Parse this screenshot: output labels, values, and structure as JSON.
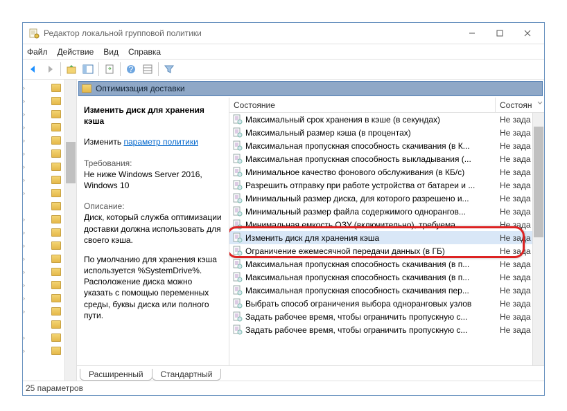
{
  "window": {
    "title": "Редактор локальной групповой политики"
  },
  "menu": {
    "file": "Файл",
    "action": "Действие",
    "view": "Вид",
    "help": "Справка"
  },
  "path_header": "Оптимизация доставки",
  "desc": {
    "setting_title": "Изменить диск для хранения кэша",
    "edit_label": "Изменить",
    "edit_link": "параметр политики",
    "req_label": "Требования:",
    "req_body": "Не ниже Windows Server 2016, Windows 10",
    "desc_label": "Описание:",
    "desc_body": "Диск, который служба оптимизации доставки должна использовать для своего кэша.",
    "desc_body2": "По умолчанию для хранения кэша используется %SystemDrive%. Расположение диска можно указать с помощью переменных среды, буквы диска или полного пути."
  },
  "columns": {
    "state": "Состояние",
    "state2": "Состоян"
  },
  "rows": [
    {
      "name": "Максимальный срок хранения в кэше (в секундах)",
      "state": "Не зада"
    },
    {
      "name": "Максимальный размер кэша (в процентах)",
      "state": "Не зада"
    },
    {
      "name": "Максимальная пропускная способность скачивания (в К...",
      "state": "Не зада"
    },
    {
      "name": "Максимальная пропускная способность выкладывания (...",
      "state": "Не зада"
    },
    {
      "name": "Минимальное качество фонового обслуживания (в КБ/с)",
      "state": "Не зада"
    },
    {
      "name": "Разрешить отправку при работе устройства от батареи и ...",
      "state": "Не зада"
    },
    {
      "name": "Минимальный размер диска, для которого разрешено и...",
      "state": "Не зада"
    },
    {
      "name": "Минимальный размер файла содержимого однорангов...",
      "state": "Не зада"
    },
    {
      "name": "Минимальная емкость ОЗУ (включительно), требуема...",
      "state": "Не зада"
    },
    {
      "name": "Изменить диск для хранения кэша",
      "state": "Не зада",
      "selected": true
    },
    {
      "name": "Ограничение ежемесячной передачи данных (в ГБ)",
      "state": "Не зада"
    },
    {
      "name": "Максимальная пропускная способность скачивания (в п...",
      "state": "Не зада"
    },
    {
      "name": "Максимальная пропускная способность скачивания (в п...",
      "state": "Не зада"
    },
    {
      "name": "Максимальная пропускная способность скачивания пер...",
      "state": "Не зада"
    },
    {
      "name": "Выбрать способ ограничения выбора одноранговых узлов",
      "state": "Не зада"
    },
    {
      "name": "Задать рабочее время, чтобы ограничить пропускную с...",
      "state": "Не зада"
    },
    {
      "name": "Задать рабочее время, чтобы ограничить пропускную с...",
      "state": "Не зада"
    }
  ],
  "tabs": {
    "extended": "Расширенный",
    "standard": "Стандартный"
  },
  "status": "25 параметров"
}
